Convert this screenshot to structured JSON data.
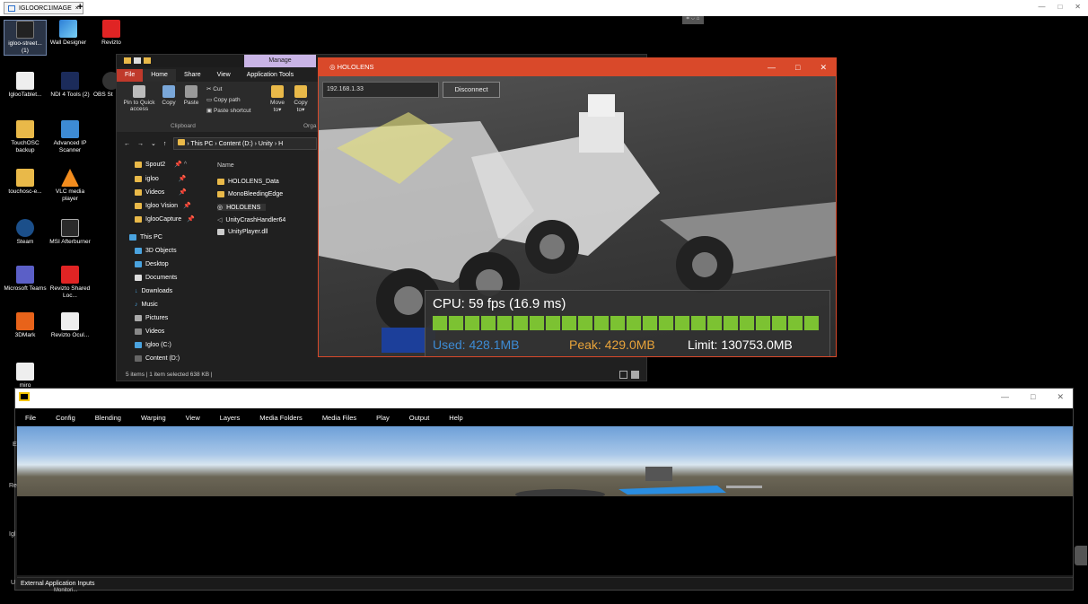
{
  "browser": {
    "tab_label": "IGLOORC1IMAGE",
    "tab_close": "×",
    "new_tab": "+",
    "window_controls": [
      "—",
      "□",
      "✕"
    ],
    "mid_control": "⌗ ⌵ ⌂"
  },
  "desktop": {
    "icons": [
      {
        "label": "igloo-street... (1)",
        "icon": "igloo-icon"
      },
      {
        "label": "Wall Designer",
        "icon": "wall-designer-icon"
      },
      {
        "label": "Revizto",
        "icon": "revizto-icon"
      },
      {
        "label": "IglooTablet...",
        "icon": "document-icon"
      },
      {
        "label": "NDI 4 Tools (2)",
        "icon": "ndi-icon"
      },
      {
        "label": "OBS St",
        "icon": "obs-icon"
      },
      {
        "label": "TouchOSC backup",
        "icon": "folder-icon"
      },
      {
        "label": "Advanced IP Scanner",
        "icon": "network-icon"
      },
      {
        "label": "touchosc-e...",
        "icon": "archive-icon"
      },
      {
        "label": "VLC media player",
        "icon": "vlc-icon"
      },
      {
        "label": "Steam",
        "icon": "steam-icon"
      },
      {
        "label": "MSI Afterburner",
        "icon": "msi-icon"
      },
      {
        "label": "Microsoft Teams",
        "icon": "teams-icon"
      },
      {
        "label": "Revizto Shared Loc...",
        "icon": "revizto-icon"
      },
      {
        "label": "3DMark",
        "icon": "3dmark-icon"
      },
      {
        "label": "Revizto Ocul...",
        "icon": "revizto-icon"
      },
      {
        "label": "miro",
        "icon": "document-icon"
      }
    ],
    "edge_labels": [
      "E",
      "Re",
      "Igl",
      "U",
      "Monitori..."
    ]
  },
  "explorer": {
    "manage_tab": "Manage",
    "tabs": [
      "File",
      "Home",
      "Share",
      "View",
      "Application Tools"
    ],
    "ribbon": {
      "pin": "Pin to Quick access",
      "copy": "Copy",
      "paste": "Paste",
      "cut": "Cut",
      "copy_path": "Copy path",
      "paste_shortcut": "Paste shortcut",
      "move_to": "Move to▾",
      "copy_to": "Copy to▾",
      "group_clipboard": "Clipboard",
      "group_organize": "Orga"
    },
    "address": "› This PC › Content (D:) › Unity › H",
    "nav_items": [
      {
        "label": "Spout2",
        "type": "folder",
        "pin": "📌 ^"
      },
      {
        "label": "igloo",
        "type": "folder",
        "pin": "📌"
      },
      {
        "label": "Videos",
        "type": "folder",
        "pin": "📌"
      },
      {
        "label": "Igloo Vision",
        "type": "folder",
        "pin": "📌"
      },
      {
        "label": "IglooCapture",
        "type": "folder",
        "pin": "📌"
      },
      {
        "label": "This PC",
        "type": "drive"
      },
      {
        "label": "3D Objects",
        "type": "drive"
      },
      {
        "label": "Desktop",
        "type": "drive"
      },
      {
        "label": "Documents",
        "type": "drive"
      },
      {
        "label": "Downloads",
        "type": "drive"
      },
      {
        "label": "Music",
        "type": "drive"
      },
      {
        "label": "Pictures",
        "type": "drive"
      },
      {
        "label": "Videos",
        "type": "drive"
      },
      {
        "label": "Igloo (C:)",
        "type": "drive"
      },
      {
        "label": "Content (D:)",
        "type": "drive"
      }
    ],
    "column_header": "Name",
    "files": [
      "HOLOLENS_Data",
      "MonoBleedingEdge",
      "HOLOLENS",
      "UnityCrashHandler64",
      "UnityPlayer.dll"
    ],
    "status": "5 items  |  1 item selected  638 KB  |"
  },
  "hololens": {
    "title": "HOLOLENS",
    "window_controls": [
      "—",
      "□",
      "✕"
    ],
    "ip_value": "192.168.1.33",
    "connect_label": "Disconnect",
    "cpu": "CPU: 59 fps (16.9 ms)",
    "used": "Used: 428.1MB",
    "peak": "Peak: 429.0MB",
    "limit": "Limit: 130753.0MB",
    "cpu_fill": 1.0,
    "colors": {
      "used": "#3d8bd4",
      "peak": "#e8a33a",
      "limit": "#ffffff",
      "bar": "#7cc232",
      "accent": "#d9492a"
    }
  },
  "igloo": {
    "window_controls": [
      "—",
      "□",
      "✕"
    ],
    "menu": [
      "File",
      "Config",
      "Blending",
      "Warping",
      "View",
      "Layers",
      "Media Folders",
      "Media Files",
      "Play",
      "Output",
      "Help"
    ],
    "footer": "External Application Inputs"
  }
}
